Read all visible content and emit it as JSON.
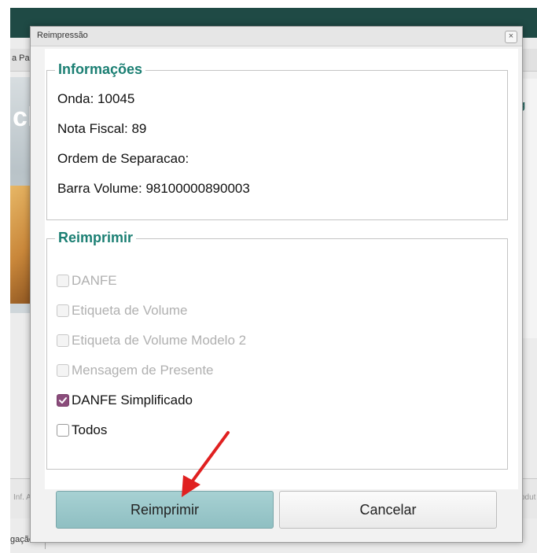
{
  "background": {
    "tab_label": "a Pa",
    "hero_text": "ck",
    "right_text": "ig",
    "bottom_left_text": "Inf. Adic",
    "bottom_right_text": "Produt",
    "status_text": "gação"
  },
  "dialog": {
    "title": "Reimpressão",
    "close_icon": "×",
    "info": {
      "legend": "Informações",
      "onda": "Onda: 10045",
      "nota_fiscal": "Nota Fiscal: 89",
      "ordem_separacao": "Ordem de Separacao:",
      "barra_volume": "Barra Volume: 98100000890003"
    },
    "reimprimir": {
      "legend": "Reimprimir",
      "options": [
        {
          "label": "DANFE",
          "checked": false,
          "enabled": false
        },
        {
          "label": "Etiqueta de Volume",
          "checked": false,
          "enabled": false
        },
        {
          "label": "Etiqueta de Volume Modelo 2",
          "checked": false,
          "enabled": false
        },
        {
          "label": "Mensagem de Presente",
          "checked": false,
          "enabled": false
        },
        {
          "label": "DANFE Simplificado",
          "checked": true,
          "enabled": true
        },
        {
          "label": "Todos",
          "checked": false,
          "enabled": true
        }
      ]
    },
    "buttons": {
      "reimprimir": "Reimprimir",
      "cancelar": "Cancelar"
    }
  },
  "colors": {
    "legend": "#1b7f73",
    "checked": "#8a4c7b",
    "primary_button": "#9cc8cb",
    "annotation_arrow": "#e02020"
  }
}
